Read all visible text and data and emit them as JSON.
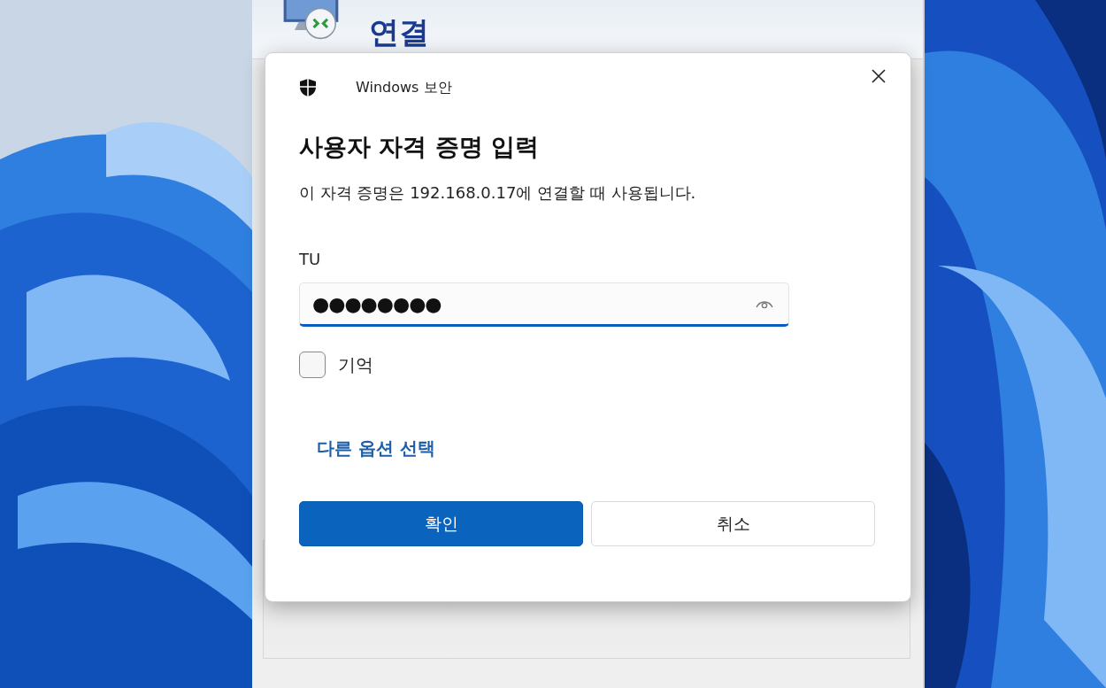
{
  "remote_window": {
    "title": "연결"
  },
  "dialog": {
    "app": "Windows 보안",
    "heading": "사용자 자격 증명 입력",
    "description": "이 자격 증명은 192.168.0.17에 연결할 때 사용됩니다.",
    "username": "TU",
    "password": {
      "value": "●●●●●●●●",
      "focused": true
    },
    "remember": {
      "label": "기억",
      "checked": false
    },
    "more_options": "다른 옵션 선택",
    "buttons": [
      {
        "label": "확인",
        "kind": "primary"
      },
      {
        "label": "취소",
        "kind": "secondary"
      }
    ]
  }
}
